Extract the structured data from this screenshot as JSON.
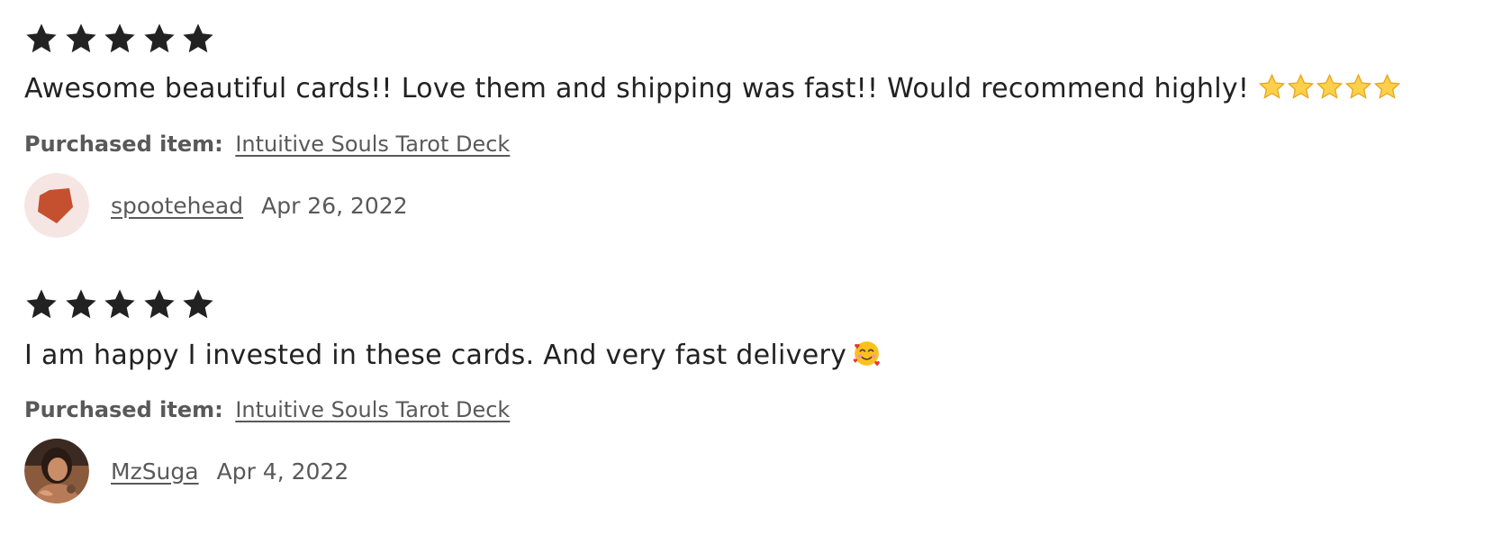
{
  "reviews": [
    {
      "rating": 5,
      "text": "Awesome beautiful cards!! Love them and shipping was fast!! Would recommend highly!",
      "trailing_emoji": "star-emoji x5",
      "purchased_label": "Purchased item:",
      "purchased_item": "Intuitive Souls Tarot Deck",
      "username": "spootehead",
      "date": "Apr 26, 2022",
      "avatar": "orange-pentagon-avatar"
    },
    {
      "rating": 5,
      "text": "I am happy I invested in these cards. And very fast delivery",
      "trailing_emoji": "smiling-face-with-hearts-emoji",
      "purchased_label": "Purchased item:",
      "purchased_item": "Intuitive Souls Tarot Deck",
      "username": "MzSuga",
      "date": "Apr 4, 2022",
      "avatar": "user-photo-avatar"
    }
  ],
  "colors": {
    "star": "#222222",
    "text": "#222222",
    "muted": "#595959",
    "avatar_bg": "#f5e6e3",
    "avatar_shape": "#c4502f",
    "emoji_star": "#fcd04b"
  }
}
